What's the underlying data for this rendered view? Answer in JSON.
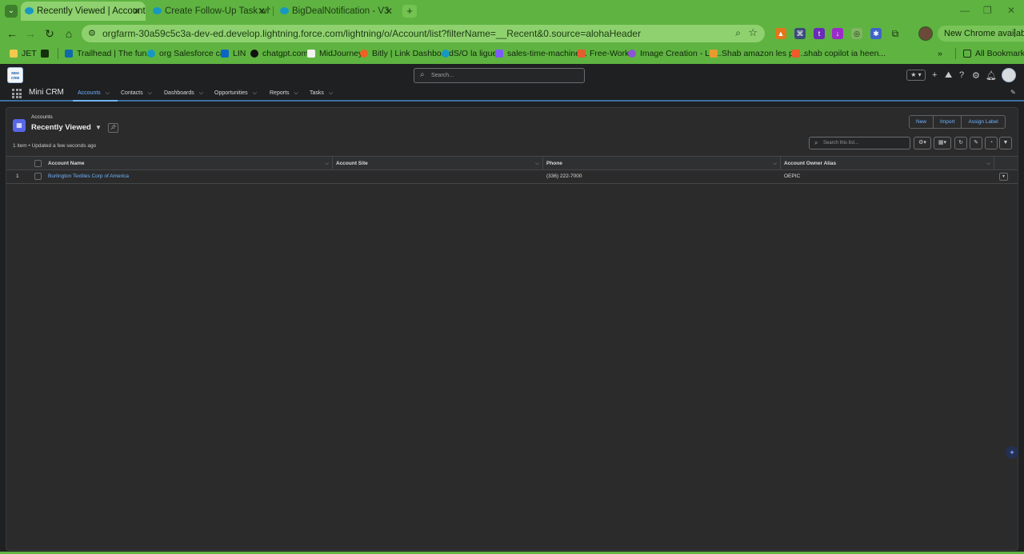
{
  "browser": {
    "tabs": [
      {
        "title": "Recently Viewed | Accounts | S",
        "active": true
      },
      {
        "title": "Create Follow-Up Task when Cl",
        "active": false
      },
      {
        "title": "BigDealNotification - V3",
        "active": false
      }
    ],
    "new_tab_label": "+",
    "url": "orgfarm-30a59c5c3a-dev-ed.develop.lightning.force.com/lightning/o/Account/list?filterName=__Recent&0.source=alohaHeader",
    "update_label": "New Chrome available",
    "bookmarks": [
      {
        "label": "JET",
        "color": "#f2c94c"
      },
      {
        "label": "",
        "color": "#15300c"
      },
      {
        "label": "Trailhead | The fun...",
        "color": "#0f6aa8"
      },
      {
        "label": "org Salesforce cali",
        "color": "#1798c1"
      },
      {
        "label": "LIN",
        "color": "#0a66c2"
      },
      {
        "label": "chatgpt.com",
        "color": "#111111"
      },
      {
        "label": "MidJourney",
        "color": "#f2f2f2"
      },
      {
        "label": "Bitly | Link Dashboard",
        "color": "#ee6123"
      },
      {
        "label": "S/O la ligue",
        "color": "#1798c1"
      },
      {
        "label": "sales-time-machine...",
        "color": "#7a5cff"
      },
      {
        "label": "Free-Work",
        "color": "#e35d2e"
      },
      {
        "label": "Image Creation - Le...",
        "color": "#8c54d6"
      },
      {
        "label": "Shab amazon les ph...",
        "color": "#e89b2d"
      },
      {
        "label": "shab copilot ia heen...",
        "color": "#f05a28"
      }
    ],
    "all_bookmarks_label": "All Bookmarks"
  },
  "sf": {
    "app_logo_text": "MINI CRM",
    "search_placeholder": "Search...",
    "app_name": "Mini CRM",
    "nav_items": [
      {
        "label": "Accounts",
        "active": true
      },
      {
        "label": "Contacts",
        "active": false
      },
      {
        "label": "Dashboards",
        "active": false
      },
      {
        "label": "Opportunities",
        "active": false
      },
      {
        "label": "Reports",
        "active": false
      },
      {
        "label": "Tasks",
        "active": false
      }
    ]
  },
  "list": {
    "breadcrumb": "Accounts",
    "title": "Recently Viewed",
    "meta": "1 item • Updated a few seconds ago",
    "buttons": [
      "New",
      "Import",
      "Assign Label"
    ],
    "search_placeholder": "Search this list...",
    "columns": [
      "Account Name",
      "Account Site",
      "Phone",
      "Account Owner Alias"
    ],
    "rows": [
      {
        "num": "1",
        "name": "Burlington Textiles Corp of America",
        "site": "",
        "phone": "(336) 222-7000",
        "owner": "OEPIC"
      }
    ]
  }
}
